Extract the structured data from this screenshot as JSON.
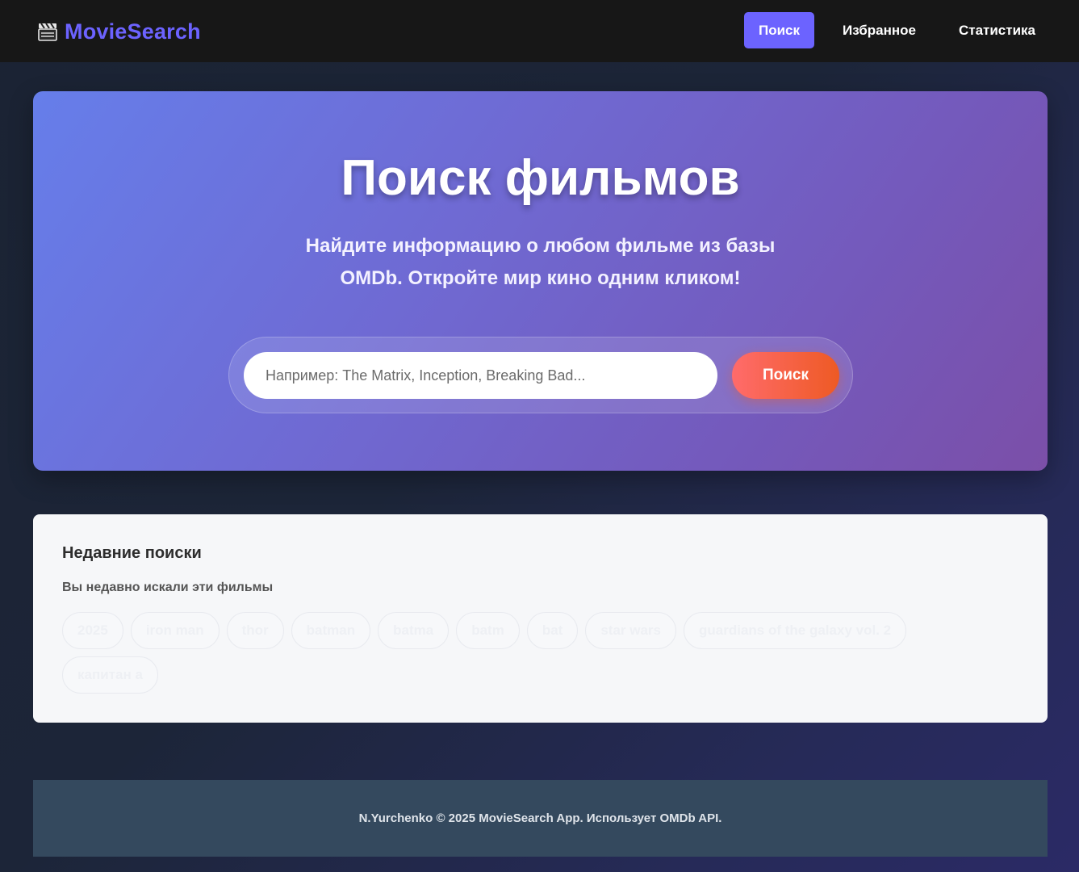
{
  "header": {
    "brand_icon": "clapperboard-icon",
    "brand": "MovieSearch",
    "nav": [
      {
        "label": "Поиск",
        "active": true
      },
      {
        "label": "Избранное",
        "active": false
      },
      {
        "label": "Статистика",
        "active": false
      }
    ]
  },
  "hero": {
    "title": "Поиск фильмов",
    "subtitle": "Найдите информацию о любом фильме из базы OMDb. Откройте мир кино одним кликом!",
    "search": {
      "placeholder": "Например: The Matrix, Inception, Breaking Bad...",
      "value": "",
      "button_label": "Поиск"
    }
  },
  "recent": {
    "title": "Недавние поиски",
    "subtitle": "Вы недавно искали эти фильмы",
    "items": [
      "2025",
      "iron man",
      "thor",
      "batman",
      "batma",
      "batm",
      "bat",
      "star wars",
      "guardians of the galaxy vol. 2",
      "капитан а"
    ]
  },
  "footer": {
    "text": "N.Yurchenko © 2025 MovieSearch App. Использует OMDb API."
  },
  "colors": {
    "accent": "#6c63ff",
    "hero_gradient_start": "#667eea",
    "hero_gradient_end": "#7b4fa8",
    "search_button_start": "#ff6b6b",
    "search_button_end": "#ee5a24",
    "footer_bg": "#34495e"
  }
}
